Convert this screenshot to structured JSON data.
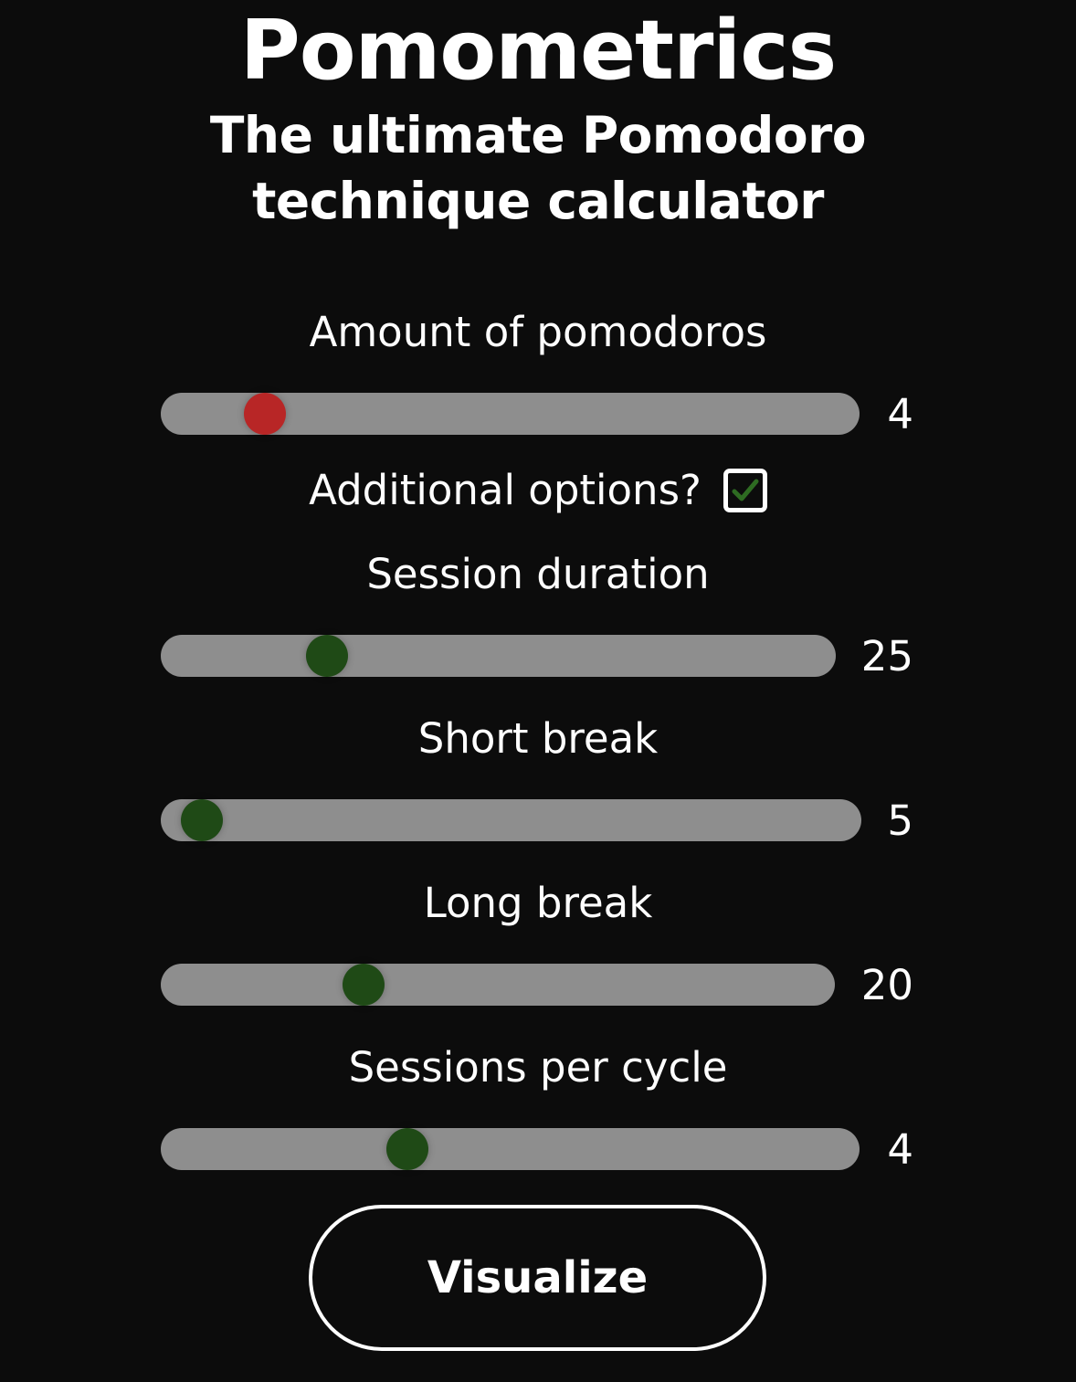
{
  "app": {
    "title": "Pomometrics",
    "subtitle": "The ultimate Pomodoro technique calculator"
  },
  "colors": {
    "background": "#0c0c0c",
    "track": "#8e8e8e",
    "thumb_red": "#b82626",
    "thumb_green": "#1f4a16",
    "checkmark": "#2e6b22"
  },
  "sliders": [
    {
      "label": "Amount of pomodoros",
      "value": "4",
      "fraction": 0.127,
      "thumb_color": "red"
    },
    {
      "label": "Session duration",
      "value": "25",
      "fraction": 0.229,
      "thumb_color": "green"
    },
    {
      "label": "Short break",
      "value": "5",
      "fraction": 0.03,
      "thumb_color": "green"
    },
    {
      "label": "Long break",
      "value": "20",
      "fraction": 0.287,
      "thumb_color": "green"
    },
    {
      "label": "Sessions per cycle",
      "value": "4",
      "fraction": 0.343,
      "thumb_color": "green"
    }
  ],
  "options": {
    "label": "Additional options?",
    "checked": true,
    "icon": "checkmark-icon"
  },
  "actions": {
    "visualize_label": "Visualize"
  }
}
